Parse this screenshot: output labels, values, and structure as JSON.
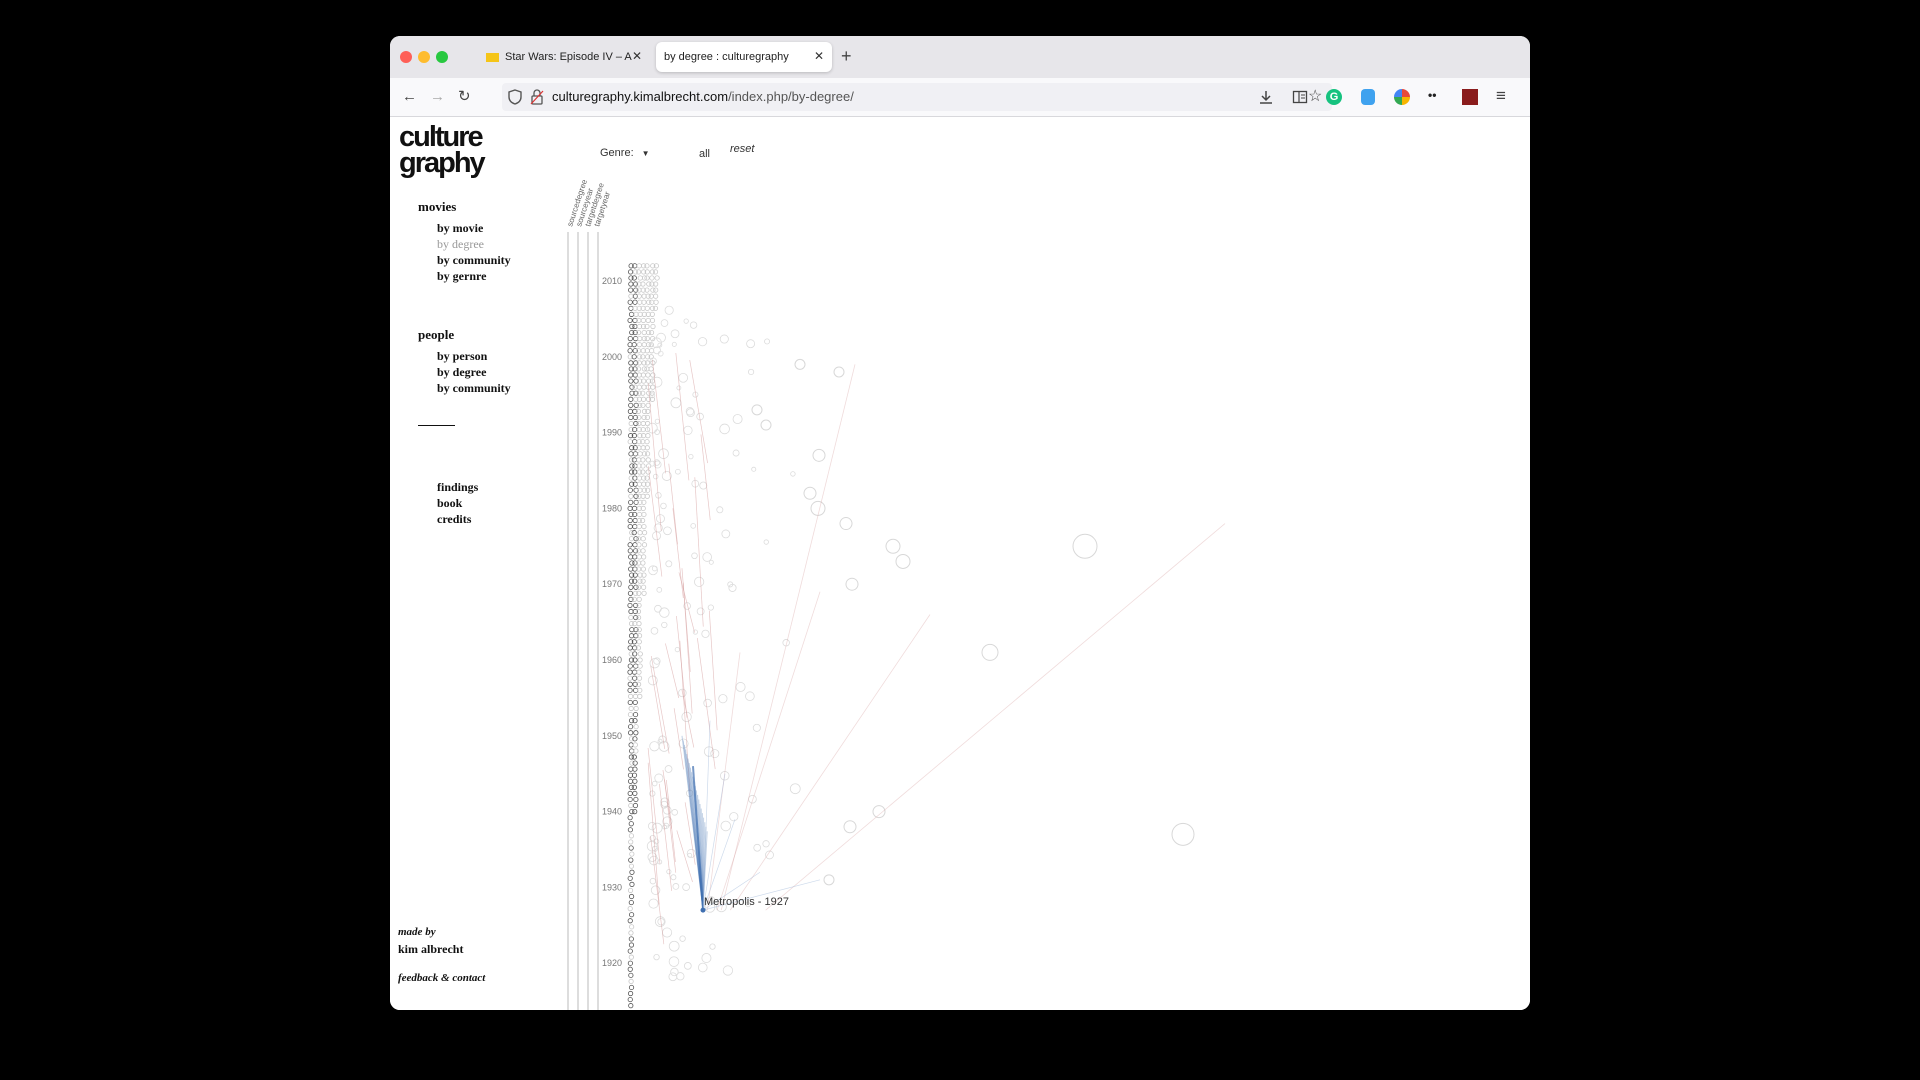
{
  "browser": {
    "tabs": [
      {
        "title": "Star Wars: Episode IV – A New H",
        "active": false
      },
      {
        "title": "by degree : culturegraphy",
        "active": true
      }
    ],
    "url_domain": "culturegraphy.kimalbrecht.com",
    "url_path": "/index.php/by-degree/",
    "new_tab": "+",
    "extension_label": "••"
  },
  "site": {
    "logo_line1": "culture",
    "logo_line2": "graphy"
  },
  "sidebar": {
    "movies_title": "movies",
    "movies_items": [
      {
        "label": "by movie",
        "active": false
      },
      {
        "label": "by degree",
        "active": true
      },
      {
        "label": "by community",
        "active": false
      },
      {
        "label": "by gernre",
        "active": false
      }
    ],
    "people_title": "people",
    "people_items": [
      {
        "label": "by person"
      },
      {
        "label": "by degree"
      },
      {
        "label": "by community"
      }
    ],
    "misc_items": [
      {
        "label": "findings"
      },
      {
        "label": "book"
      },
      {
        "label": "credits"
      }
    ],
    "made_by": "made by",
    "author": "kim albrecht",
    "feedback": "feedback & contact"
  },
  "controls": {
    "genre_label": "Genre:",
    "all_label": "all",
    "reset_label": "reset"
  },
  "chart_data": {
    "type": "scatter",
    "column_headers": [
      "sourcedegree",
      "sourceyear",
      "targetdegree",
      "targetyear"
    ],
    "year_ticks": [
      2010,
      2000,
      1990,
      1980,
      1970,
      1960,
      1950,
      1940,
      1930,
      1920
    ],
    "highlight_label": "Metropolis - 1927",
    "highlight_year": 1927,
    "colors": {
      "influence_to": "#3f6fb0",
      "influence_from": "#d49a9a",
      "node": "#cccccc"
    }
  }
}
